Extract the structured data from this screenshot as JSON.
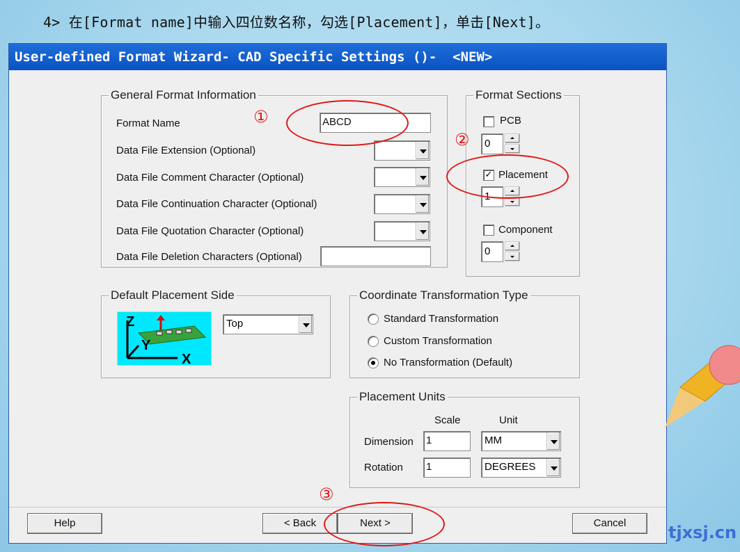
{
  "instruction": "4> 在[Format name]中输入四位数名称，勾选[Placement]，单击[Next]。",
  "dialog": {
    "title": "User-defined Format Wizard- CAD Specific Settings ()-  <NEW>"
  },
  "general": {
    "title": "General Format Information",
    "format_name_label": "Format Name",
    "format_name_value": "ABCD",
    "ext_label": "Data File Extension (Optional)",
    "comment_label": "Data File Comment Character (Optional)",
    "continuation_label": "Data File Continuation Character (Optional)",
    "quotation_label": "Data File Quotation Character (Optional)",
    "deletion_label": "Data File Deletion Characters (Optional)"
  },
  "sections": {
    "title": "Format Sections",
    "pcb_label": "PCB",
    "pcb_value": "0",
    "placement_label": "Placement",
    "placement_checked": "✓",
    "placement_value": "1",
    "component_label": "Component",
    "component_value": "0"
  },
  "placement_side": {
    "title": "Default Placement Side",
    "value": "Top",
    "axis_z": "Z",
    "axis_y": "Y",
    "axis_x": "X"
  },
  "coord": {
    "title": "Coordinate Transformation Type",
    "opt1": "Standard Transformation",
    "opt2": "Custom Transformation",
    "opt3": "No Transformation (Default)"
  },
  "units": {
    "title": "Placement Units",
    "scale_header": "Scale",
    "unit_header": "Unit",
    "dimension_label": "Dimension",
    "dimension_scale": "1",
    "dimension_unit": "MM",
    "rotation_label": "Rotation",
    "rotation_scale": "1",
    "rotation_unit": "DEGREES"
  },
  "buttons": {
    "help": "Help",
    "back": "< Back",
    "next": "Next >",
    "cancel": "Cancel"
  },
  "markers": {
    "one": "①",
    "two": "②",
    "three": "③"
  },
  "watermark": "tjxsj.cn"
}
